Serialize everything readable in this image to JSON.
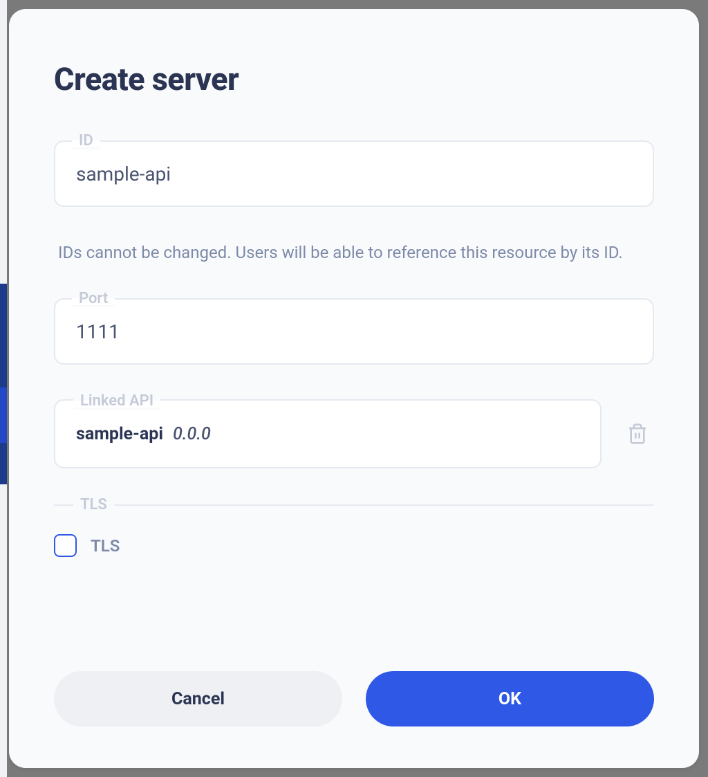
{
  "dialog": {
    "title": "Create server",
    "fields": {
      "id": {
        "label": "ID",
        "value": "sample-api",
        "helper": "IDs cannot be changed. Users will be able to reference this resource by its ID."
      },
      "port": {
        "label": "Port",
        "value": "1111"
      },
      "linkedApi": {
        "label": "Linked API",
        "name": "sample-api",
        "version": "0.0.0"
      },
      "tls": {
        "sectionLabel": "TLS",
        "checkboxLabel": "TLS",
        "checked": false
      }
    },
    "buttons": {
      "cancel": "Cancel",
      "ok": "OK"
    }
  },
  "icons": {
    "trash": "trash-icon"
  },
  "colors": {
    "accent": "#2f58e6",
    "textDark": "#2b3553",
    "textMuted": "#7d8aa8",
    "border": "#e5e9f0"
  }
}
